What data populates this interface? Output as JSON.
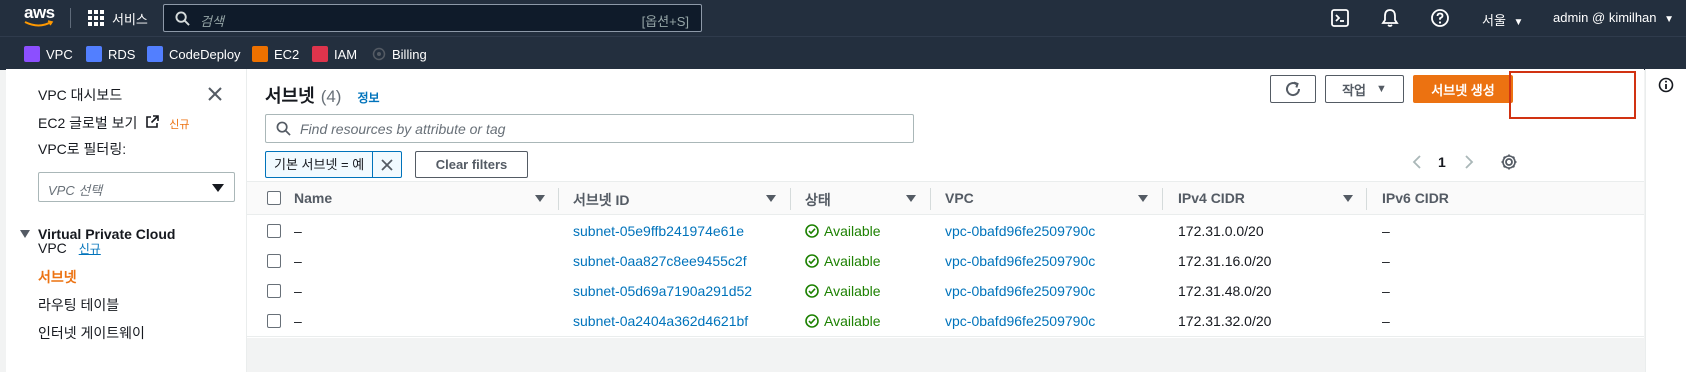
{
  "topbar": {
    "logo_text": "aws",
    "services_label": "서비스",
    "search_placeholder": "검색",
    "search_shortcut": "[옵션+S]",
    "region": "서울",
    "account": "admin @ kimilhan"
  },
  "favorites": [
    {
      "label": "VPC",
      "color": "#8c4fff"
    },
    {
      "label": "RDS",
      "color": "#527fff"
    },
    {
      "label": "CodeDeploy",
      "color": "#527fff"
    },
    {
      "label": "EC2",
      "color": "#ed7100"
    },
    {
      "label": "IAM",
      "color": "#dd344c"
    },
    {
      "label": "Billing",
      "color": "#232f3e"
    }
  ],
  "sidebar": {
    "dashboard": "VPC 대시보드",
    "ec2_global": "EC2 글로벌 보기",
    "ec2_global_badge": "신규",
    "filter_label": "VPC로 필터링:",
    "filter_placeholder": "VPC 선택",
    "section": "Virtual Private Cloud",
    "items": [
      {
        "label": "VPC",
        "badge": "신규"
      },
      {
        "label": "서브넷"
      },
      {
        "label": "라우팅 테이블"
      },
      {
        "label": "인터넷 게이트웨이"
      }
    ]
  },
  "main": {
    "title": "서브넷",
    "count": "(4)",
    "info_link": "정보",
    "actions_label": "작업",
    "create_label": "서브넷 생성",
    "filter_placeholder": "Find resources by attribute or tag",
    "token_label": "기본 서브넷 = 예",
    "clear_filters": "Clear filters",
    "page_number": "1"
  },
  "table": {
    "columns": [
      "Name",
      "서브넷 ID",
      "상태",
      "VPC",
      "IPv4 CIDR",
      "IPv6 CIDR"
    ],
    "rows": [
      {
        "name": "–",
        "subnet_id": "subnet-05e9ffb241974e61e",
        "status": "Available",
        "vpc": "vpc-0bafd96fe2509790c",
        "ipv4": "172.31.0.0/20",
        "ipv6": "–"
      },
      {
        "name": "–",
        "subnet_id": "subnet-0aa827c8ee9455c2f",
        "status": "Available",
        "vpc": "vpc-0bafd96fe2509790c",
        "ipv4": "172.31.16.0/20",
        "ipv6": "–"
      },
      {
        "name": "–",
        "subnet_id": "subnet-05d69a7190a291d52",
        "status": "Available",
        "vpc": "vpc-0bafd96fe2509790c",
        "ipv4": "172.31.48.0/20",
        "ipv6": "–"
      },
      {
        "name": "–",
        "subnet_id": "subnet-0a2404a362d4621bf",
        "status": "Available",
        "vpc": "vpc-0bafd96fe2509790c",
        "ipv4": "172.31.32.0/20",
        "ipv6": "–"
      }
    ]
  },
  "icons": {
    "grid": "grid-icon",
    "search": "search-icon",
    "cloudshell": "terminal-icon",
    "notifications": "bell-icon",
    "help": "help-icon",
    "close": "close-icon",
    "refresh": "refresh-icon",
    "settings": "gear-icon",
    "info": "info-icon",
    "status_ok": "check-circle-icon"
  },
  "colors": {
    "accent_orange": "#ec7211",
    "link_blue": "#0073bb",
    "success_green": "#1d8102",
    "topbar": "#232f3e",
    "highlight_red": "#d13212"
  }
}
